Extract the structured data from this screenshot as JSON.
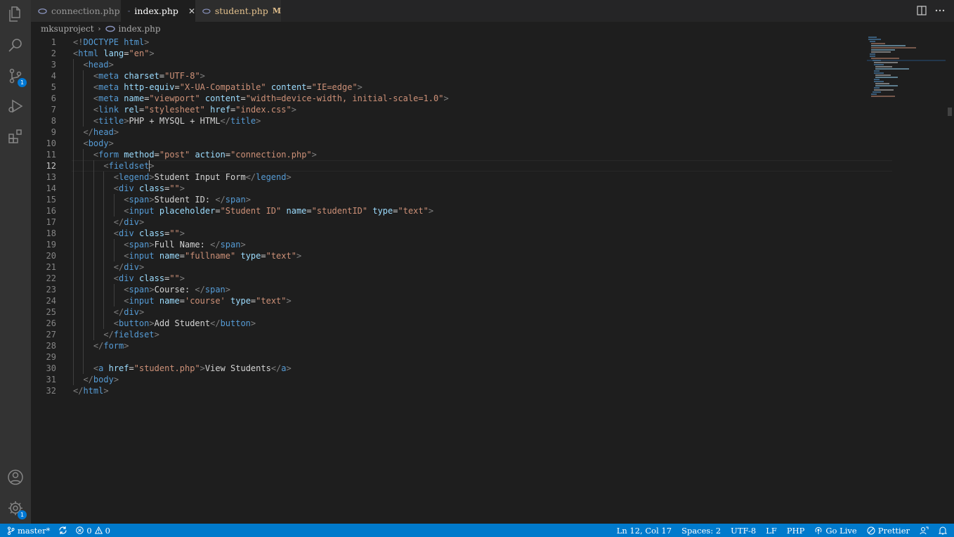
{
  "tabs": [
    {
      "label": "connection.php",
      "active": false,
      "modified": ""
    },
    {
      "label": "index.php",
      "active": true,
      "modified": ""
    },
    {
      "label": "student.php",
      "active": false,
      "modified": "M"
    }
  ],
  "breadcrumb": {
    "folder": "mksuproject",
    "file": "index.php"
  },
  "badges": {
    "source_control": "1",
    "settings": "1"
  },
  "editor": {
    "current_line": 12,
    "lines": [
      {
        "n": "1",
        "t": "<!DOCTYPE html>"
      },
      {
        "n": "2",
        "t": "<html lang=\"en\">"
      },
      {
        "n": "3",
        "t": "  <head>"
      },
      {
        "n": "4",
        "t": "    <meta charset=\"UTF-8\">"
      },
      {
        "n": "5",
        "t": "    <meta http-equiv=\"X-UA-Compatible\" content=\"IE=edge\">"
      },
      {
        "n": "6",
        "t": "    <meta name=\"viewport\" content=\"width=device-width, initial-scale=1.0\">"
      },
      {
        "n": "7",
        "t": "    <link rel=\"stylesheet\" href=\"index.css\">"
      },
      {
        "n": "8",
        "t": "    <title>PHP + MYSQL + HTML</title>"
      },
      {
        "n": "9",
        "t": "  </head>"
      },
      {
        "n": "10",
        "t": "  <body>"
      },
      {
        "n": "11",
        "t": "    <form method=\"post\" action=\"connection.php\">"
      },
      {
        "n": "12",
        "t": "      <fieldset>"
      },
      {
        "n": "13",
        "t": "        <legend>Student Input Form</legend>"
      },
      {
        "n": "14",
        "t": "        <div class=\"\">"
      },
      {
        "n": "15",
        "t": "          <span>Student ID: </span>"
      },
      {
        "n": "16",
        "t": "          <input placeholder=\"Student ID\" name=\"studentID\" type=\"text\">"
      },
      {
        "n": "17",
        "t": "        </div>"
      },
      {
        "n": "18",
        "t": "        <div class=\"\">"
      },
      {
        "n": "19",
        "t": "          <span>Full Name: </span>"
      },
      {
        "n": "20",
        "t": "          <input name=\"fullname\" type=\"text\">"
      },
      {
        "n": "21",
        "t": "        </div>"
      },
      {
        "n": "22",
        "t": "        <div class=\"\">"
      },
      {
        "n": "23",
        "t": "          <span>Course: </span>"
      },
      {
        "n": "24",
        "t": "          <input name='course' type=\"text\">"
      },
      {
        "n": "25",
        "t": "        </div>"
      },
      {
        "n": "26",
        "t": "        <button>Add Student</button>"
      },
      {
        "n": "27",
        "t": "      </fieldset>"
      },
      {
        "n": "28",
        "t": "    </form>"
      },
      {
        "n": "29",
        "t": ""
      },
      {
        "n": "30",
        "t": "    <a href=\"student.php\">View Students</a>"
      },
      {
        "n": "31",
        "t": "  </body>"
      },
      {
        "n": "32",
        "t": "</html>"
      }
    ]
  },
  "status": {
    "branch": "master*",
    "errors": "0",
    "warnings": "0",
    "position": "Ln 12, Col 17",
    "spaces": "Spaces: 2",
    "encoding": "UTF-8",
    "eol": "LF",
    "language": "PHP",
    "golive": "Go Live",
    "prettier": "Prettier"
  },
  "colors": {
    "statusbar": "#007acc",
    "editor_bg": "#1e1e1e",
    "activity_bg": "#333333",
    "badge": "#0078d4"
  }
}
